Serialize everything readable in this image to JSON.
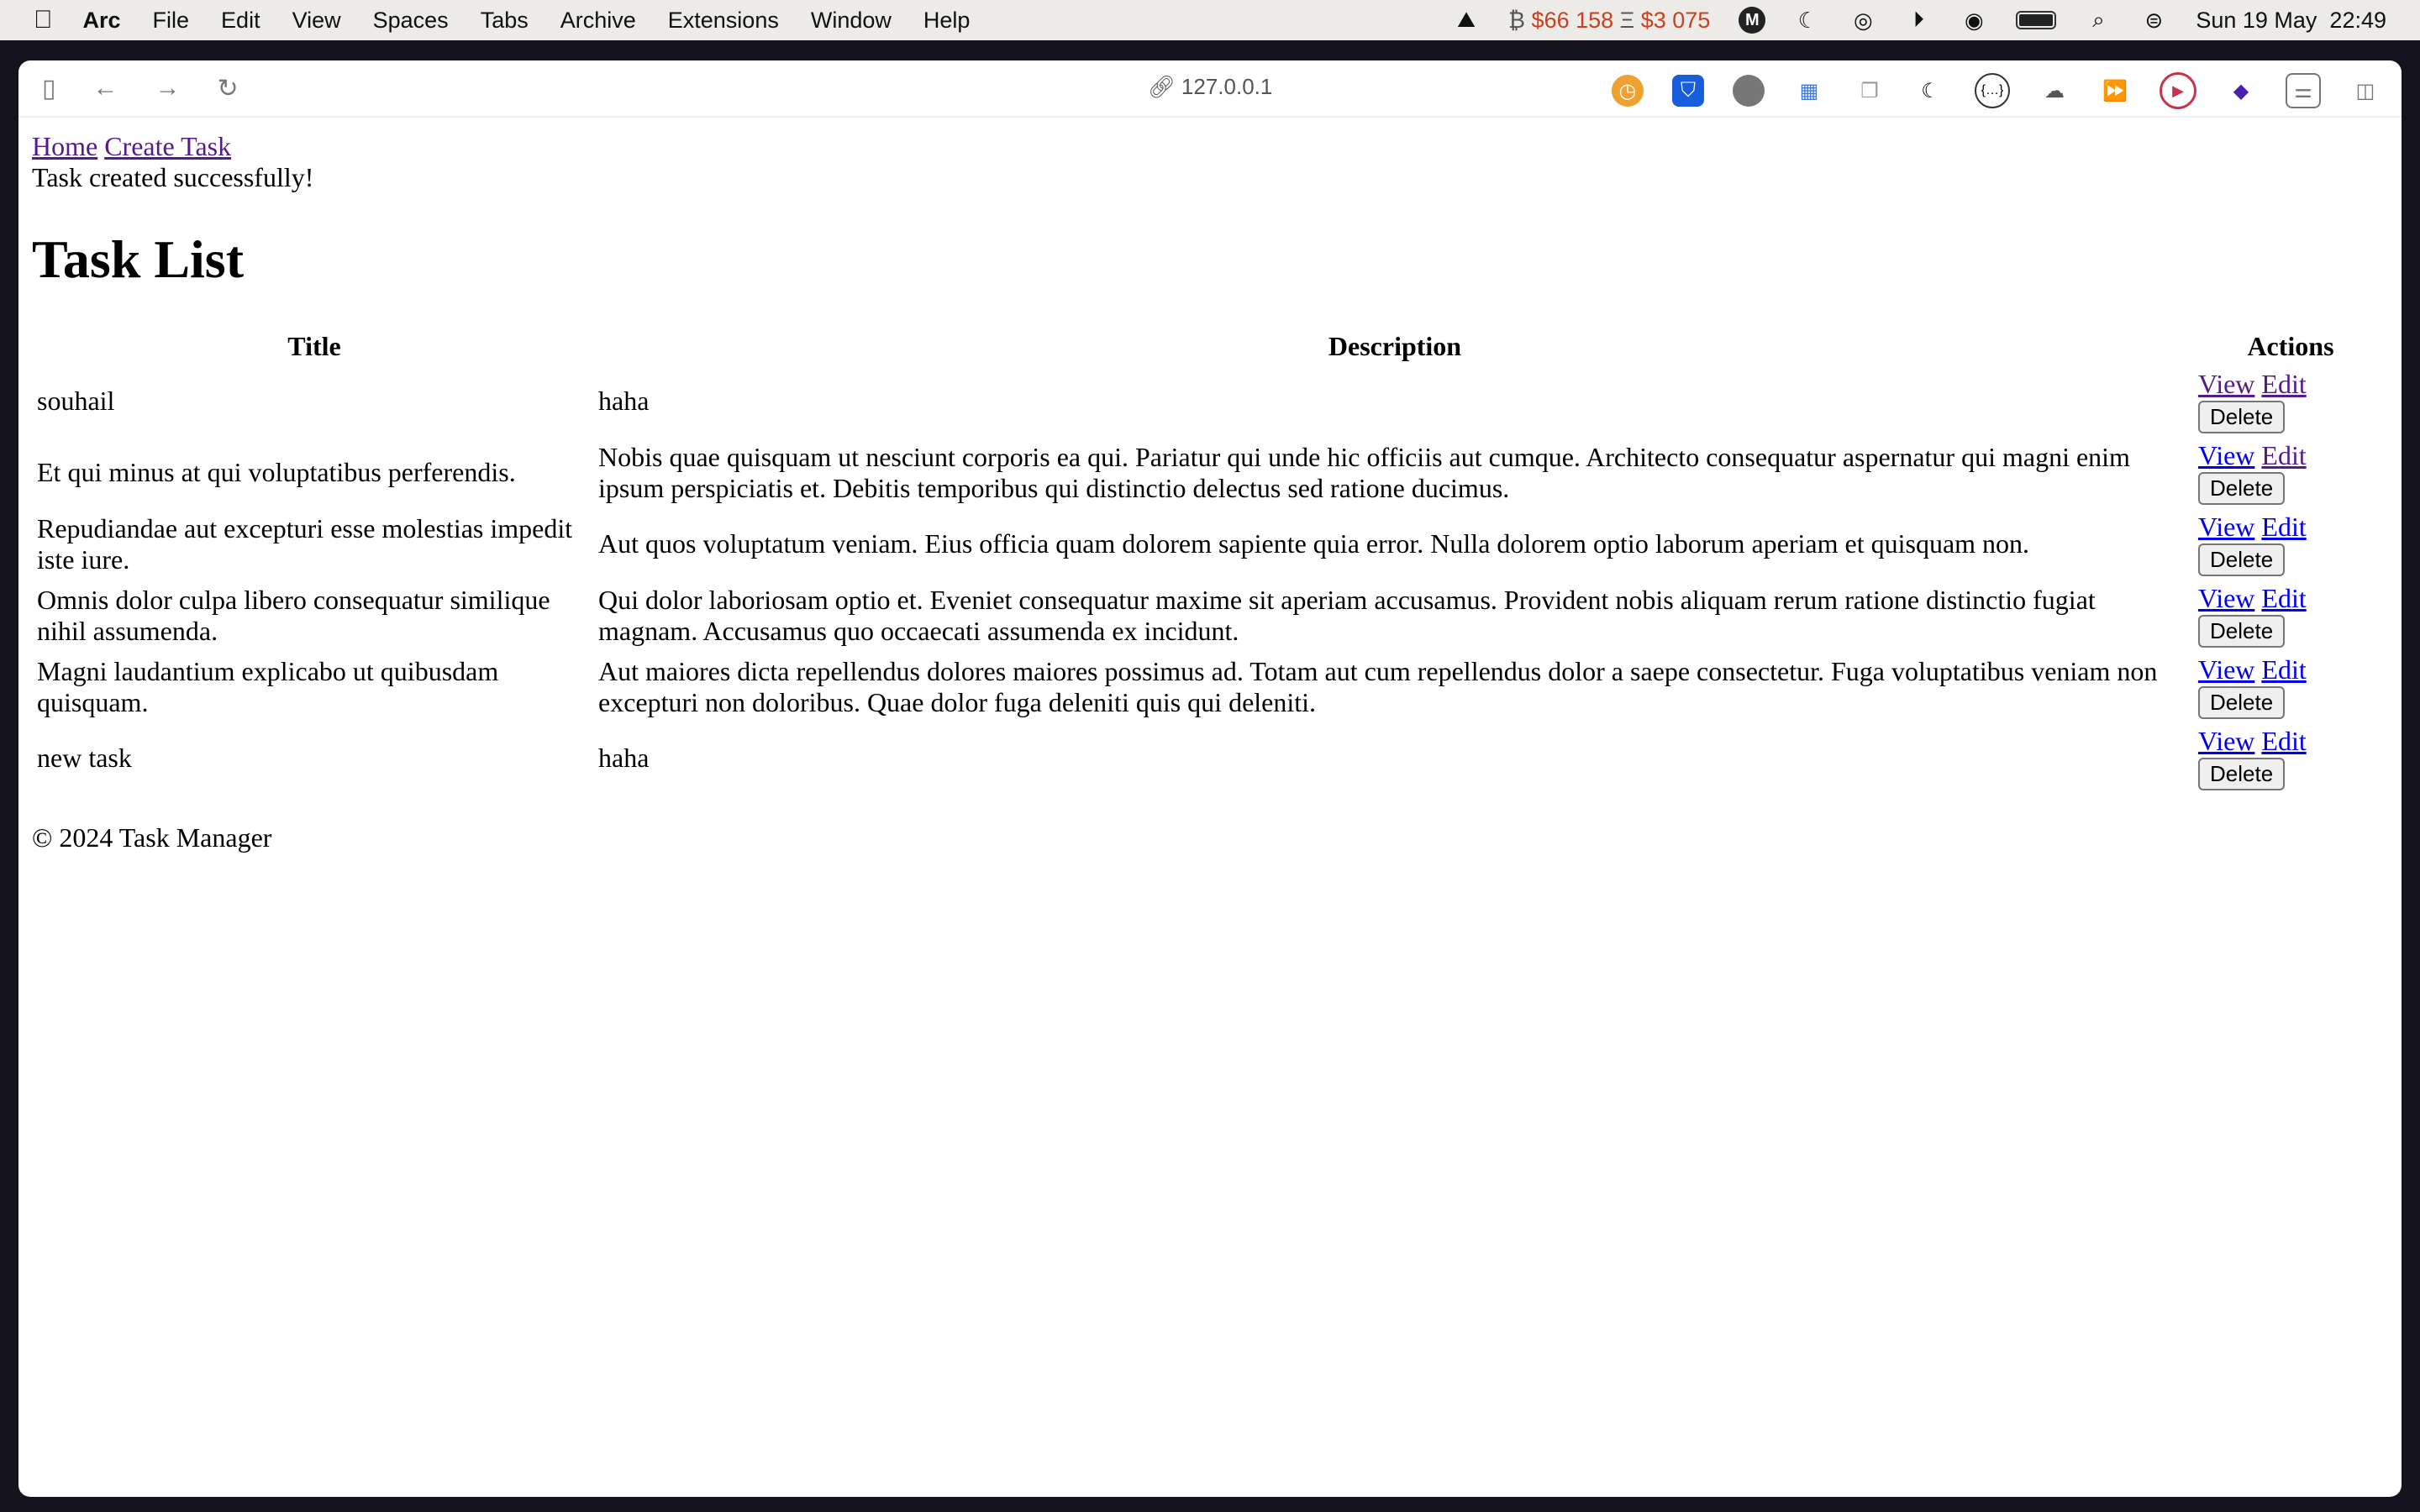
{
  "menubar": {
    "app": "Arc",
    "items": [
      "File",
      "Edit",
      "View",
      "Spaces",
      "Tabs",
      "Archive",
      "Extensions",
      "Window",
      "Help"
    ],
    "btc_symbol": "₿",
    "btc_price": "$66 158",
    "eth_symbol": "Ξ",
    "eth_price": "$3 075",
    "datetime": "Sun 19 May  22:49"
  },
  "browser": {
    "url": "127.0.0.1"
  },
  "nav": {
    "home": "Home",
    "create": "Create Task"
  },
  "flash": "Task created successfully!",
  "title": "Task List",
  "table": {
    "headers": [
      "Title",
      "Description",
      "Actions"
    ],
    "view_label": "View",
    "edit_label": "Edit",
    "delete_label": "Delete",
    "rows": [
      {
        "title": "souhail",
        "description": "haha",
        "view_visited": true,
        "edit_visited": true
      },
      {
        "title": "Et qui minus at qui voluptatibus perferendis.",
        "description": "Nobis quae quisquam ut nesciunt corporis ea qui. Pariatur qui unde hic officiis aut cumque. Architecto consequatur aspernatur qui magni enim ipsum perspiciatis et. Debitis temporibus qui distinctio delectus sed ratione ducimus.",
        "view_visited": false,
        "edit_visited": true
      },
      {
        "title": "Repudiandae aut excepturi esse molestias impedit iste iure.",
        "description": "Aut quos voluptatum veniam. Eius officia quam dolorem sapiente quia error. Nulla dolorem optio laborum aperiam et quisquam non.",
        "view_visited": false,
        "edit_visited": false
      },
      {
        "title": "Omnis dolor culpa libero consequatur similique nihil assumenda.",
        "description": "Qui dolor laboriosam optio et. Eveniet consequatur maxime sit aperiam accusamus. Provident nobis aliquam rerum ratione distinctio fugiat magnam. Accusamus quo occaecati assumenda ex incidunt.",
        "view_visited": false,
        "edit_visited": false
      },
      {
        "title": "Magni laudantium explicabo ut quibusdam quisquam.",
        "description": "Aut maiores dicta repellendus dolores maiores possimus ad. Totam aut cum repellendus dolor a saepe consectetur. Fuga voluptatibus veniam non excepturi non doloribus. Quae dolor fuga deleniti quis qui deleniti.",
        "view_visited": false,
        "edit_visited": false
      },
      {
        "title": "new task",
        "description": "haha",
        "view_visited": false,
        "edit_visited": false
      }
    ]
  },
  "footer": "© 2024 Task Manager"
}
